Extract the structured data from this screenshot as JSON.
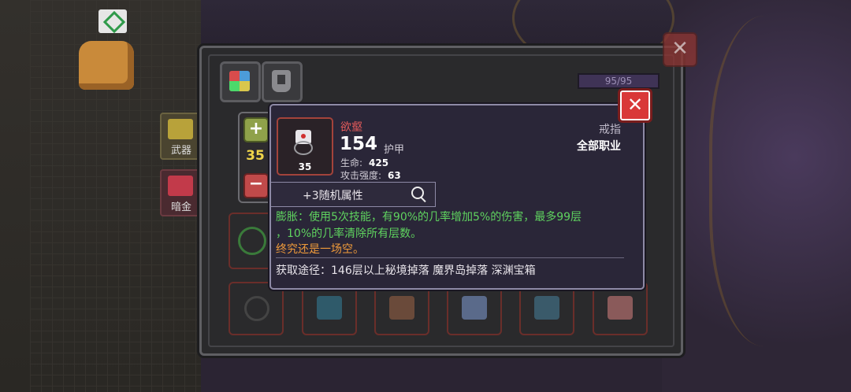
{
  "sidebar": {
    "weapon_label": "武器",
    "darkgold_label": "暗金"
  },
  "inventory": {
    "capacity": "95/95",
    "quantity": "35"
  },
  "item": {
    "name": "欲壑",
    "armor_value": "154",
    "armor_label": "护甲",
    "stats": [
      {
        "label": "生命:",
        "value": "425"
      },
      {
        "label": "攻击强度:",
        "value": "63"
      }
    ],
    "type": "戒指",
    "class": "全部职业",
    "level": "35",
    "random_attr": "+3随机属性",
    "effect_line1": "膨胀：使用5次技能，有90%的几率增加5%的伤害，最多99层",
    "effect_line2": "，10%的几率清除所有层数。",
    "flavor": "终究还是一场空。",
    "source": "获取途径：146层以上秘境掉落 魔界岛掉落 深渊宝箱"
  },
  "colors": {
    "name": "#e25a5a",
    "effect": "#5fd35f",
    "flavor": "#ee9a3a",
    "level_number": "#f0d54a"
  }
}
